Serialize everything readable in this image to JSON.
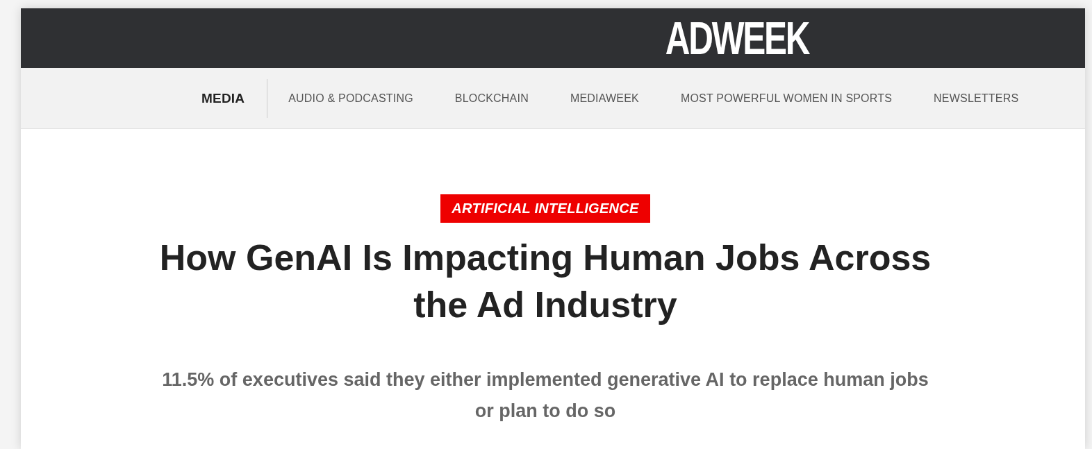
{
  "header": {
    "logo": "ADWEEK"
  },
  "nav": {
    "items": [
      {
        "label": "MEDIA",
        "selected": true
      },
      {
        "label": "AUDIO & PODCASTING",
        "selected": false
      },
      {
        "label": "BLOCKCHAIN",
        "selected": false
      },
      {
        "label": "MEDIAWEEK",
        "selected": false
      },
      {
        "label": "MOST POWERFUL WOMEN IN SPORTS",
        "selected": false
      },
      {
        "label": "NEWSLETTERS",
        "selected": false
      }
    ]
  },
  "article": {
    "category": "ARTIFICIAL INTELLIGENCE",
    "headline": "How GenAI Is Impacting Human Jobs Across the Ad Industry",
    "subtitle": "11.5% of executives said they either implemented generative AI to replace human jobs or plan to do so"
  }
}
